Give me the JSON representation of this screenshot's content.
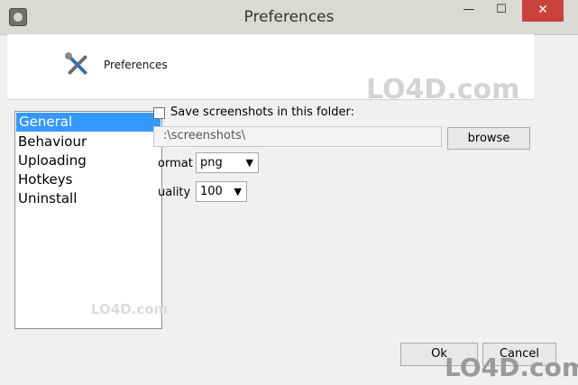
{
  "window": {
    "title": "Preferences",
    "min_symbol": "—",
    "max_symbol": "☐",
    "close_symbol": "✕"
  },
  "header": {
    "title": "Preferences",
    "icon": "tools-icon"
  },
  "categories": [
    "General",
    "Behaviour",
    "Uploading",
    "Hotkeys",
    "Uninstall"
  ],
  "selected_category": "General",
  "general": {
    "save_label": "Save screenshots in this folder:",
    "folder_value": ":\\screenshots\\",
    "browse_label": "browse",
    "format_label": "ormat",
    "format_value": "png",
    "quality_label": "uality",
    "quality_value": "100"
  },
  "footer": {
    "ok_label": "Ok",
    "cancel_label": "Cancel"
  },
  "watermark": {
    "text": "LO4D.com"
  },
  "colors": {
    "selection": "#3399ff",
    "close": "#c7433c"
  }
}
